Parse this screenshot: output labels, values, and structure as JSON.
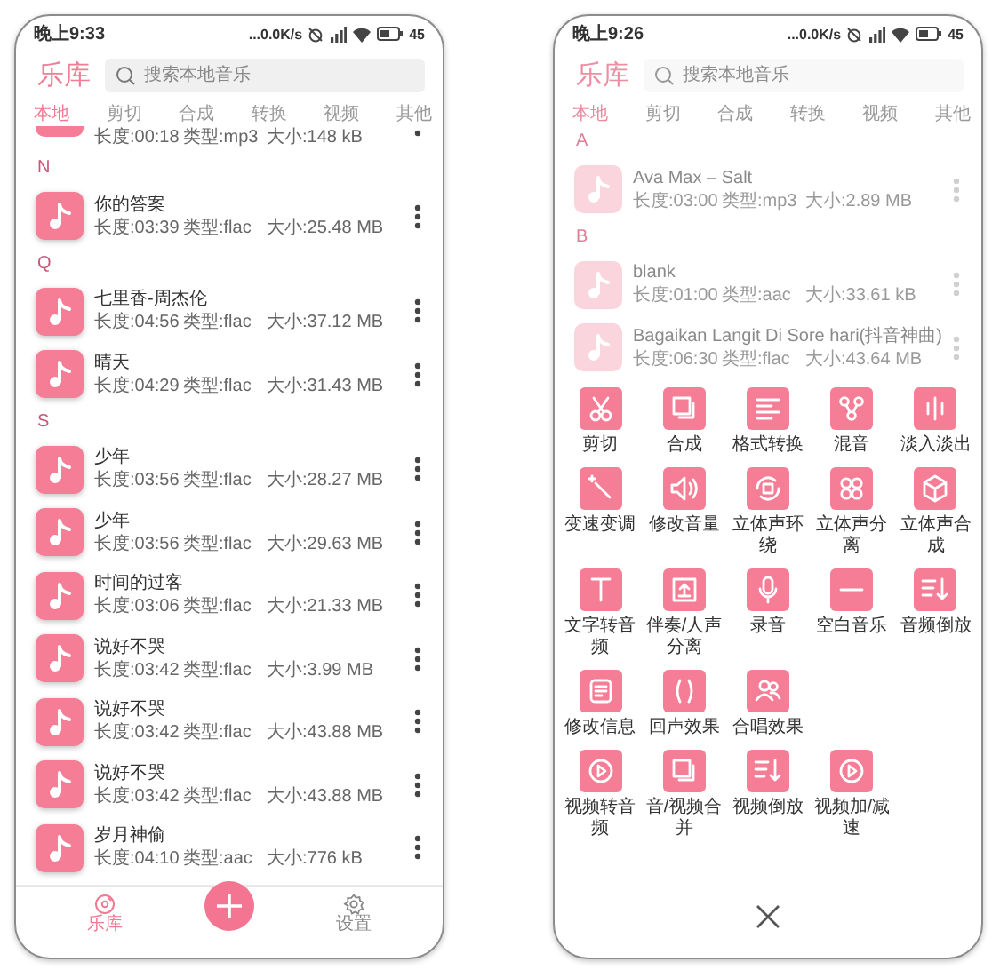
{
  "screens": [
    {
      "dimmed": false,
      "status_bar": {
        "time": "晚上9:33",
        "network": "...0.0K/s",
        "battery": "45"
      },
      "header": {
        "title": "乐库",
        "search_placeholder": "搜索本地音乐"
      },
      "tabs": [
        {
          "label": "本地",
          "selected": true
        },
        {
          "label": "剪切",
          "selected": false
        },
        {
          "label": "合成",
          "selected": false
        },
        {
          "label": "转换",
          "selected": false
        },
        {
          "label": "视频",
          "selected": false
        },
        {
          "label": "其他",
          "selected": false
        }
      ],
      "sections": [
        {
          "songs": [
            {
              "partial": true,
              "length": "长度:00:18",
              "type": "类型:mp3",
              "size": "大小:148 kB"
            }
          ]
        },
        {
          "letter": "N",
          "songs": [
            {
              "partial": false,
              "title": "你的答案",
              "length": "长度:03:39",
              "type": "类型:flac",
              "size": "大小:25.48 MB"
            }
          ]
        },
        {
          "letter": "Q",
          "songs": [
            {
              "partial": false,
              "title": "七里香-周杰伦",
              "length": "长度:04:56",
              "type": "类型:flac",
              "size": "大小:37.12 MB"
            },
            {
              "partial": false,
              "title": "晴天",
              "length": "长度:04:29",
              "type": "类型:flac",
              "size": "大小:31.43 MB"
            }
          ]
        },
        {
          "letter": "S",
          "songs": [
            {
              "partial": false,
              "title": "少年",
              "length": "长度:03:56",
              "type": "类型:flac",
              "size": "大小:28.27 MB"
            },
            {
              "partial": false,
              "title": "少年",
              "length": "长度:03:56",
              "type": "类型:flac",
              "size": "大小:29.63 MB"
            },
            {
              "partial": false,
              "title": "时间的过客",
              "length": "长度:03:06",
              "type": "类型:flac",
              "size": "大小:21.33 MB"
            },
            {
              "partial": false,
              "title": "说好不哭",
              "length": "长度:03:42",
              "type": "类型:flac",
              "size": "大小:3.99 MB"
            },
            {
              "partial": false,
              "title": "说好不哭",
              "length": "长度:03:42",
              "type": "类型:flac",
              "size": "大小:43.88 MB"
            },
            {
              "partial": false,
              "title": "说好不哭",
              "length": "长度:03:42",
              "type": "类型:flac",
              "size": "大小:43.88 MB"
            },
            {
              "partial": false,
              "title": "岁月神偷",
              "length": "长度:04:10",
              "type": "类型:aac",
              "size": "大小:776 kB"
            }
          ]
        }
      ],
      "bottom_nav": {
        "items": [
          {
            "kind": "library",
            "label": "乐库",
            "selected": true
          },
          {
            "kind": "settings",
            "label": "设置",
            "selected": false
          }
        ]
      }
    },
    {
      "dimmed": true,
      "status_bar": {
        "time": "晚上9:26",
        "network": "...0.0K/s",
        "battery": "45"
      },
      "header": {
        "title": "乐库",
        "search_placeholder": "搜索本地音乐"
      },
      "tabs": [
        {
          "label": "本地",
          "selected": true
        },
        {
          "label": "剪切",
          "selected": false
        },
        {
          "label": "合成",
          "selected": false
        },
        {
          "label": "转换",
          "selected": false
        },
        {
          "label": "视频",
          "selected": false
        },
        {
          "label": "其他",
          "selected": false
        }
      ],
      "sections": [
        {
          "letter": "A",
          "songs": [
            {
              "partial": false,
              "title": "Ava Max – Salt",
              "length": "长度:03:00",
              "type": "类型:mp3",
              "size": "大小:2.89 MB"
            }
          ]
        },
        {
          "letter": "B",
          "songs": [
            {
              "partial": false,
              "title": "blank",
              "length": "长度:01:00",
              "type": "类型:aac",
              "size": "大小:33.61 kB"
            },
            {
              "partial": false,
              "title": "Bagaikan Langit Di Sore hari(抖音神曲)",
              "length": "长度:06:30",
              "type": "类型:flac",
              "size": "大小:43.64 MB"
            }
          ]
        }
      ],
      "tool_sheet": {
        "rows": [
          [
            {
              "kind": "scissors",
              "label": "剪切"
            },
            {
              "kind": "squares",
              "label": "合成"
            },
            {
              "kind": "lines",
              "label": "格式转换"
            },
            {
              "kind": "nodes",
              "label": "混音"
            },
            {
              "kind": "bars",
              "label": "淡入淡出"
            }
          ],
          [
            {
              "kind": "wand",
              "label": "变速变调"
            },
            {
              "kind": "speaker",
              "label": "修改音量"
            },
            {
              "kind": "rotate",
              "label": "立体声环绕"
            },
            {
              "kind": "circles",
              "label": "立体声分离"
            },
            {
              "kind": "cube",
              "label": "立体声合成"
            }
          ],
          [
            {
              "kind": "text",
              "label": "文字转音频"
            },
            {
              "kind": "upload",
              "label": "伴奏/人声分离"
            },
            {
              "kind": "mic",
              "label": "录音"
            },
            {
              "kind": "minus",
              "label": "空白音乐"
            },
            {
              "kind": "sortdown",
              "label": "音频倒放"
            }
          ],
          [
            {
              "kind": "doc",
              "label": "修改信息"
            },
            {
              "kind": "brackets",
              "label": "回声效果"
            },
            {
              "kind": "people",
              "label": "合唱效果"
            }
          ],
          [
            {
              "kind": "play",
              "label": "视频转音频"
            },
            {
              "kind": "squares",
              "label": "音/视频合并"
            },
            {
              "kind": "sortdown",
              "label": "视频倒放"
            },
            {
              "kind": "play",
              "label": "视频加/减速"
            }
          ]
        ]
      }
    }
  ]
}
